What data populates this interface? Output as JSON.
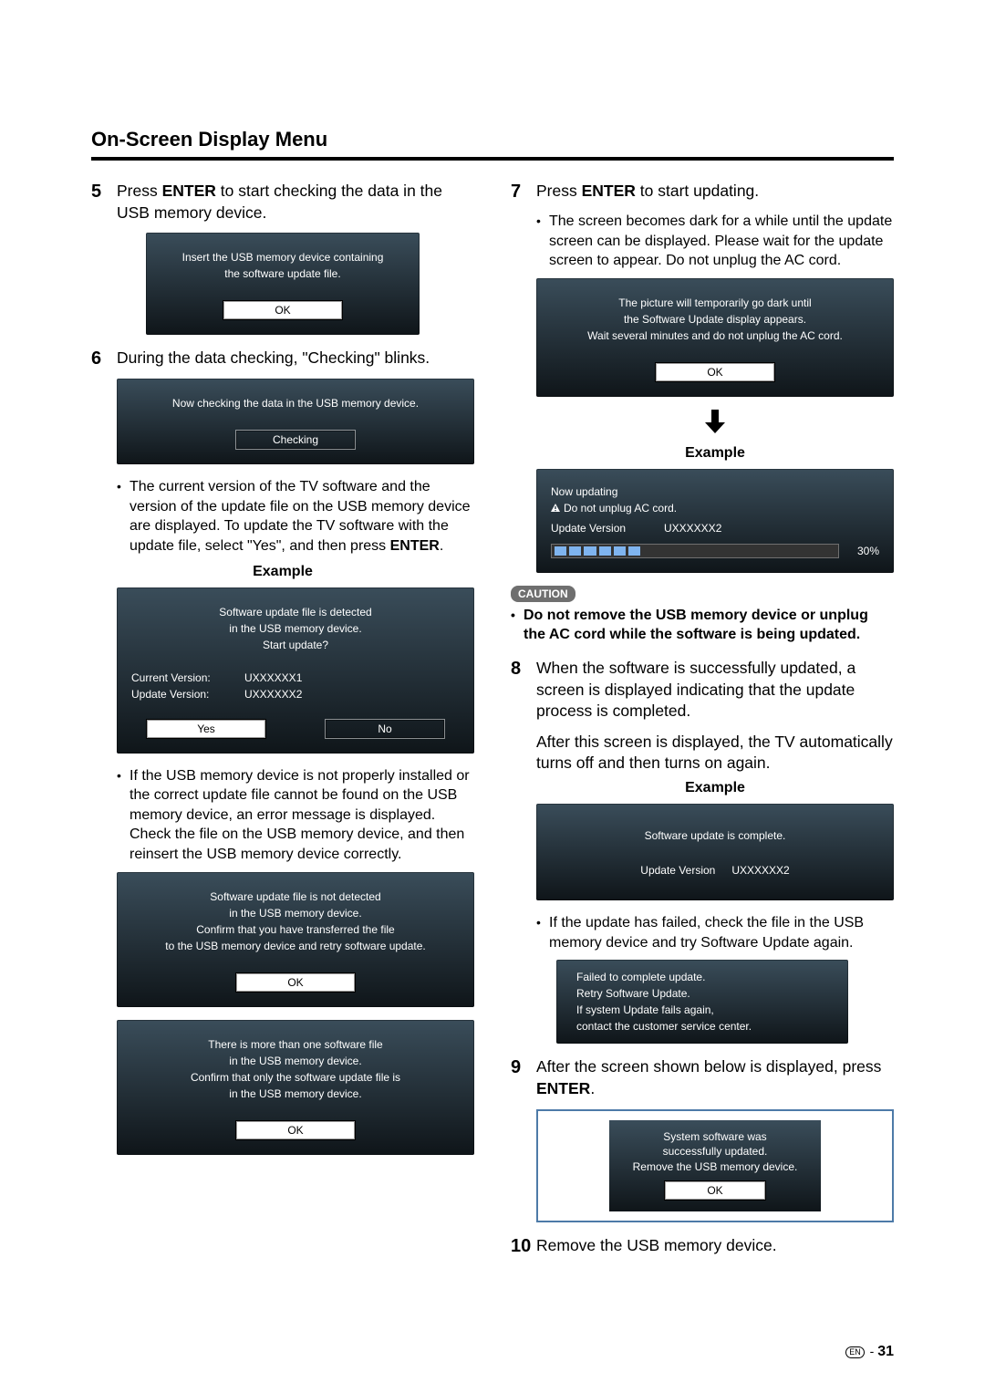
{
  "page": {
    "heading": "On-Screen Display Menu",
    "footer_lang": "EN",
    "footer_sep": " - ",
    "footer_page": "31"
  },
  "left": {
    "step5": {
      "num": "5",
      "text_pre": "Press ",
      "bold": "ENTER",
      "text_post": " to start checking the data in the USB memory device."
    },
    "panel_insert": {
      "msg": "Insert the USB memory device containing\nthe software update file.",
      "ok": "OK"
    },
    "step6": {
      "num": "6",
      "text": "During the data checking, \"Checking\" blinks."
    },
    "panel_checking": {
      "msg": "Now checking the data in the USB memory device.",
      "checking": "Checking"
    },
    "bullet_current_version": "The current version of the TV software and the version of the update file on the USB memory device are displayed. To update the TV software with the update file, select \"Yes\", and then press ",
    "bullet_current_version_bold": "ENTER",
    "bullet_current_version_post": ".",
    "example_label": "Example",
    "panel_detected": {
      "msg": "Software update file is detected\nin the USB memory device.\nStart update?",
      "row1_label": "Current Version:",
      "row1_value": "UXXXXXX1",
      "row2_label": "Update Version:",
      "row2_value": "UXXXXXX2",
      "yes": "Yes",
      "no": "No"
    },
    "bullet_not_installed": "If the USB memory device is not properly installed or the correct update file cannot be found on the USB memory device, an error message is displayed. Check the file on the USB memory device, and then reinsert the USB memory device correctly.",
    "panel_not_detected": {
      "msg": "Software update file is not detected\nin the USB memory device.\nConfirm that you have transferred the file\nto the USB memory device and retry software update.",
      "ok": "OK"
    },
    "panel_more_than_one": {
      "msg": "There is more than one software file\nin the USB memory device.\nConfirm that only the software update file is\nin the USB memory device.",
      "ok": "OK"
    }
  },
  "right": {
    "step7": {
      "num": "7",
      "text_pre": "Press ",
      "bold": "ENTER",
      "text_post": " to start updating."
    },
    "bullet_dark": "The screen becomes dark for a while until the update screen can be displayed. Please wait for the update screen to appear. Do not unplug the AC cord.",
    "panel_dark": {
      "msg": "The picture will temporarily go dark until\nthe Software Update display appears.\nWait several minutes and do not unplug the AC cord.",
      "ok": "OK"
    },
    "example_label": "Example",
    "panel_progress": {
      "line1": "Now updating",
      "line2": "Do not unplug AC cord.",
      "row_label": "Update Version",
      "row_value": "UXXXXXX2",
      "pct": "30%"
    },
    "caution_badge": "CAUTION",
    "caution_text": "Do not remove the USB memory device or unplug the AC cord while the software is being updated.",
    "step8": {
      "num": "8",
      "text": "When the software is successfully updated, a screen is displayed indicating that the update process is completed.",
      "para2": "After this screen is displayed, the TV automatically turns off and then turns on again."
    },
    "panel_complete": {
      "msg": "Software update is complete.",
      "row_label": "Update Version",
      "row_value": "UXXXXXX2"
    },
    "bullet_failed": "If the update has failed, check the file in the USB memory device and try Software Update again.",
    "panel_failed": {
      "msg": "Failed to complete update.\nRetry Software Update.\nIf system Update fails again,\ncontact the customer service center."
    },
    "step9": {
      "num": "9",
      "text_pre": "After the screen shown below is displayed, press ",
      "bold": "ENTER",
      "text_post": "."
    },
    "panel_success": {
      "msg": "System software was\nsuccessfully updated.\nRemove the USB memory device.",
      "ok": "OK"
    },
    "step10": {
      "num": "10",
      "text": "Remove the USB memory device."
    }
  }
}
